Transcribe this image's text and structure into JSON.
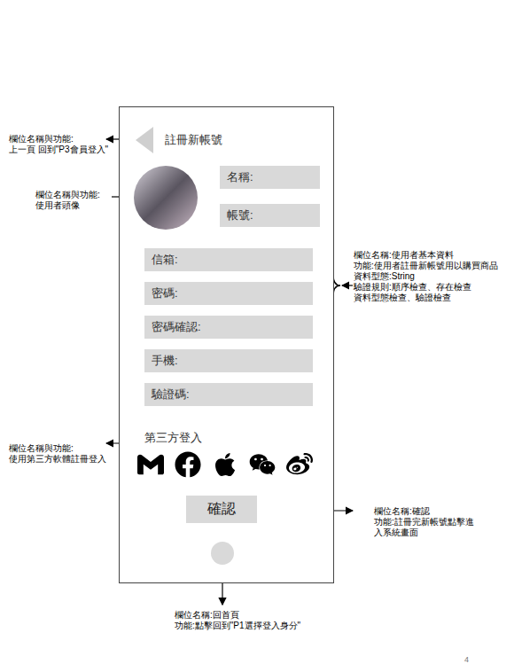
{
  "phone": {
    "header": {
      "title": "註冊新帳號"
    },
    "top_fields": [
      {
        "label": "名稱:"
      },
      {
        "label": "帳號:"
      }
    ],
    "fields": [
      {
        "label": "信箱:"
      },
      {
        "label": "密碼:"
      },
      {
        "label": "密碼確認:"
      },
      {
        "label": "手機:"
      },
      {
        "label": "驗證碼:"
      }
    ],
    "third_party": {
      "title": "第三方登入",
      "providers": [
        {
          "kind": "gmail"
        },
        {
          "kind": "facebook"
        },
        {
          "kind": "apple"
        },
        {
          "kind": "wechat"
        },
        {
          "kind": "weibo"
        }
      ]
    },
    "confirm_button": "確認"
  },
  "annotations": [
    {
      "target": "back",
      "lines": [
        "欄位名稱與功能:",
        "上一頁 回到\"P3會員登入\""
      ]
    },
    {
      "target": "avatar",
      "lines": [
        "欄位名稱與功能:",
        "使用者頭像"
      ]
    },
    {
      "target": "fields",
      "lines": [
        "欄位名稱:使用者基本資料",
        "功能:使用者註冊新帳號用以購買商品",
        "資料型態:String",
        "驗證規則:順序檢查、存在檢查",
        "資料型態檢查、驗證檢查"
      ]
    },
    {
      "target": "third-party",
      "lines": [
        "欄位名稱與功能:",
        "使用第三方軟體註冊登入"
      ]
    },
    {
      "target": "confirm",
      "lines": [
        "欄位名稱:確認",
        "功能:註冊完新帳號點擊進入系統畫面"
      ]
    },
    {
      "target": "home",
      "lines": [
        "欄位名稱:回首頁",
        "功能:點擊回到\"P1選擇登入身分\""
      ]
    }
  ],
  "page_number": "4"
}
